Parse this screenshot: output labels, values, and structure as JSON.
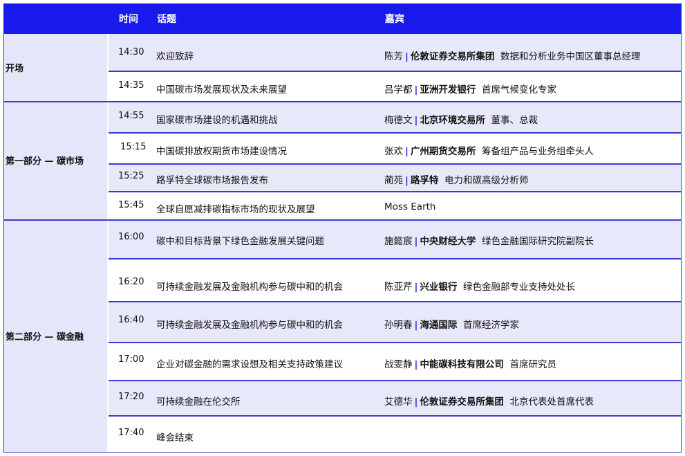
{
  "header": {
    "time": "时间",
    "topic": "话题",
    "guest": "嘉宾"
  },
  "sections": [
    {
      "label": "开场"
    },
    {
      "label": "第一部分 — 碳市场"
    },
    {
      "label": "第二部分 — 碳金融"
    }
  ],
  "rows": [
    {
      "time": "14:30",
      "topic": "欢迎致辞",
      "name": "陈芳",
      "org": "伦敦证券交易所集团",
      "title": "数据和分析业务中国区董事总经理"
    },
    {
      "time": "14:35",
      "topic": "中国碳市场发展现状及未来展望",
      "name": "吕学都",
      "org": "亚洲开发银行",
      "title": "首席气候变化专家"
    },
    {
      "time": "14:55",
      "topic": "国家碳市场建设的机遇和挑战",
      "name": "梅德文",
      "org": "北京环境交易所",
      "title": "董事、总裁"
    },
    {
      "time": "15:15",
      "topic": "中国碳排放权期货市场建设情况",
      "name": "张欢",
      "org": "广州期货交易所",
      "title": "筹备组产品与业务组牵头人"
    },
    {
      "time": "15:25",
      "topic": "路孚特全球碳市场报告发布",
      "name": "蔺苑",
      "org": "路孚特",
      "title": "电力和碳高级分析师"
    },
    {
      "time": "15:45",
      "topic": "全球自愿减排碳指标市场的现状及展望",
      "name": "Moss Earth",
      "org": "",
      "title": ""
    },
    {
      "time": "16:00",
      "topic": "碳中和目标背景下绿色金融发展关键问题",
      "name": "施懿宸",
      "org": "中央财经大学",
      "title": "绿色金融国际研究院副院长"
    },
    {
      "time": "16:20",
      "topic": "可持续金融发展及金融机构参与碳中和的机会",
      "name": "陈亚芹",
      "org": "兴业银行",
      "title": "绿色金融部专业支持处处长"
    },
    {
      "time": "16:40",
      "topic": "可持续金融发展及金融机构参与碳中和的机会",
      "name": "孙明春",
      "org": "海通国际",
      "title": "首席经济学家"
    },
    {
      "time": "17:00",
      "topic": "企业对碳金融的需求设想及相关支持政策建议",
      "name": "战雯静",
      "org": "中能碳科技有限公司",
      "title": "首席研究员"
    },
    {
      "time": "17:20",
      "topic": "可持续金融在伦交所",
      "name": "艾德华",
      "org": "伦敦证券交易所集团",
      "title": "北京代表处首席代表"
    },
    {
      "time": "17:40",
      "topic": "峰会结束",
      "name": "",
      "org": "",
      "title": ""
    }
  ]
}
